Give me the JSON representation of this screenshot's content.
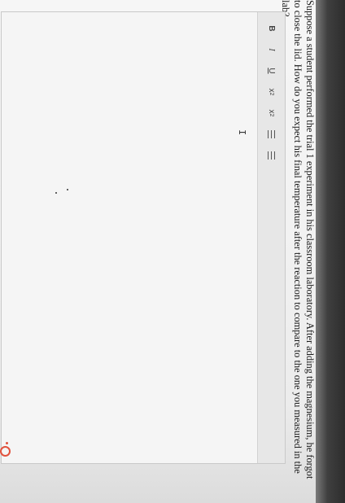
{
  "question": {
    "text": "Suppose a student performed the trial 1 experiment in his classroom laboratory. After adding the magnesium, he forgot to close the lid. How do you expect his final temperature after the reaction to compare to the one you measured in the lab?"
  },
  "toolbar": {
    "bold": "B",
    "italic": "I",
    "underline": "U",
    "subscript_base": "x",
    "subscript_mark": "2",
    "superscript_base": "x",
    "superscript_mark": "2"
  },
  "editor": {
    "cursor": "I",
    "value": ""
  },
  "icons": {
    "grammar_checker": "grammar-checker-icon",
    "accent_color": "#e1523d"
  }
}
